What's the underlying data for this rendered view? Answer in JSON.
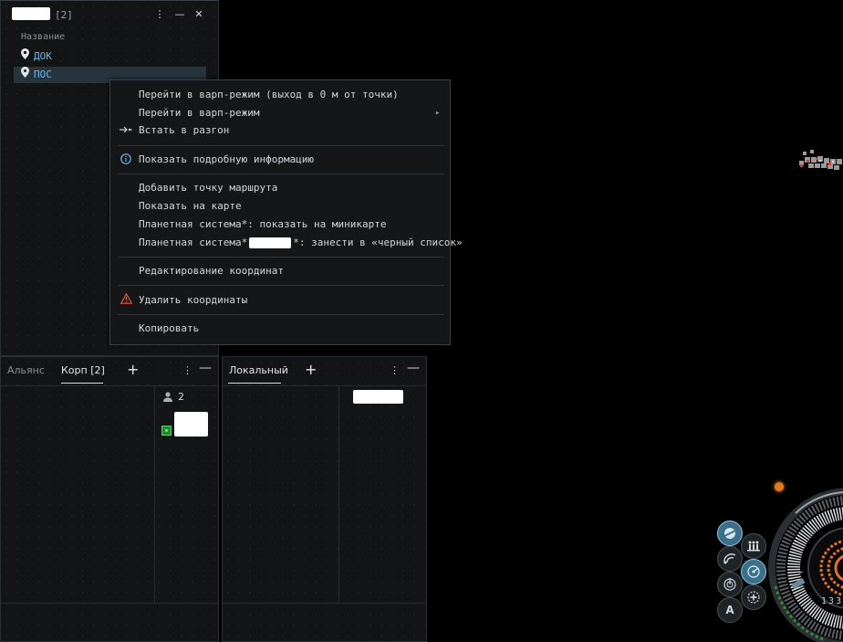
{
  "locations_window": {
    "title_count": "[2]",
    "column_header": "Название",
    "items": [
      {
        "label": "ДОК",
        "icon": "map-pin-icon"
      },
      {
        "label": "ПОС",
        "icon": "map-pin-icon"
      }
    ],
    "buttons": {
      "menu": "⋮",
      "minimize": "—",
      "close": "✕"
    }
  },
  "context_menu": {
    "items": [
      {
        "label": "Перейти в варп-режим (выход в 0 м от точки)"
      },
      {
        "label": "Перейти в варп-режим",
        "has_submenu": true
      },
      {
        "label": "Встать в разгон",
        "icon": "approach-icon"
      },
      {
        "label": "Показать подробную информацию",
        "icon": "info-icon"
      },
      {
        "label": "Добавить точку маршрута"
      },
      {
        "label": "Показать на карте"
      },
      {
        "label": "Планетная система*: показать на миникарте"
      },
      {
        "label_prefix": "Планетная система*",
        "label_suffix": "*: занести в «черный список»"
      },
      {
        "label": "Редактирование координат"
      },
      {
        "label": "Удалить координаты",
        "icon": "warning-icon"
      },
      {
        "label": "Копировать"
      }
    ],
    "submenu_arrow": "▸"
  },
  "chat_left": {
    "tabs": [
      "Альянс",
      "Корп [2]"
    ],
    "add_label": "+",
    "menu_label": "⋮",
    "minimize_label": "—",
    "member_count": "2"
  },
  "chat_right": {
    "tabs": [
      "Локальный"
    ],
    "add_label": "+",
    "menu_label": "⋮",
    "minimize_label": "—"
  },
  "hud": {
    "speed_readout": "133",
    "autopilot_label": "A",
    "colors": {
      "accent": "#3c6f8a",
      "warning": "#e05a4a",
      "orange": "#e07a1a"
    }
  }
}
